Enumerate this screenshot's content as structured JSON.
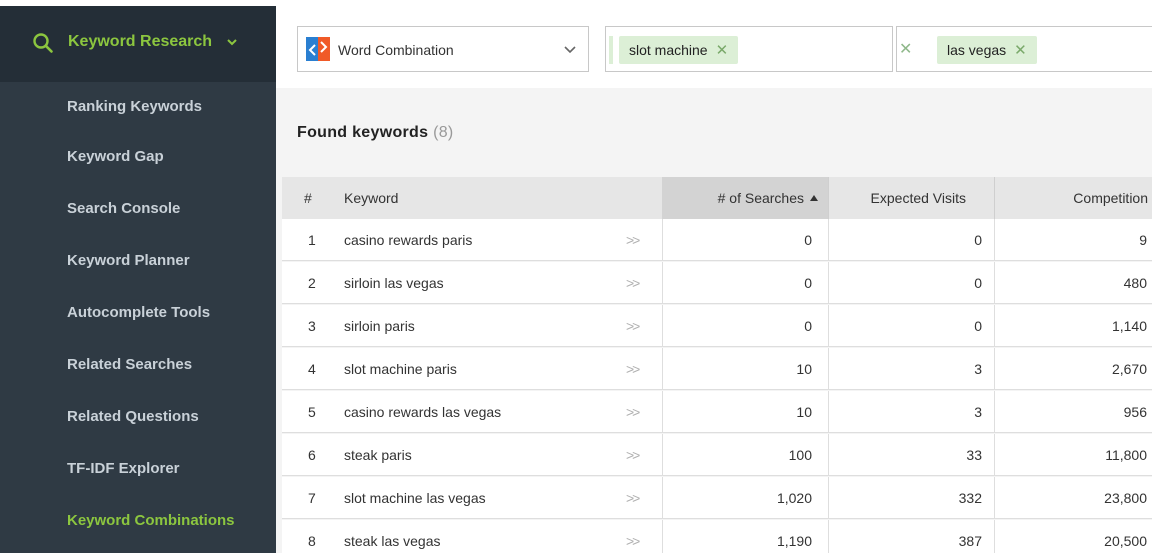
{
  "sidebar": {
    "section_title": "Keyword Research",
    "items": [
      {
        "label": "Ranking Keywords"
      },
      {
        "label": "Keyword Gap"
      },
      {
        "label": "Search Console"
      },
      {
        "label": "Keyword Planner"
      },
      {
        "label": "Autocomplete Tools"
      },
      {
        "label": "Related Searches"
      },
      {
        "label": "Related Questions"
      },
      {
        "label": "TF-IDF Explorer"
      },
      {
        "label": "Keyword Combinations",
        "active": true
      }
    ],
    "colors": {
      "bg": "#2f3a44",
      "active": "#8cc63f"
    }
  },
  "filter": {
    "method_select": "Word Combination",
    "tags_group1": [
      "slot machine"
    ],
    "tags_group2": [
      "las vegas"
    ]
  },
  "results": {
    "title": "Found keywords",
    "count": "(8)",
    "columns": {
      "num": "#",
      "keyword": "Keyword",
      "searches": "# of Searches",
      "visits": "Expected Visits",
      "competition": "Competition"
    },
    "rows": [
      {
        "num": "1",
        "keyword": "casino rewards paris",
        "searches": "0",
        "visits": "0",
        "competition": "9"
      },
      {
        "num": "2",
        "keyword": "sirloin las vegas",
        "searches": "0",
        "visits": "0",
        "competition": "480"
      },
      {
        "num": "3",
        "keyword": "sirloin paris",
        "searches": "0",
        "visits": "0",
        "competition": "1,140"
      },
      {
        "num": "4",
        "keyword": "slot machine paris",
        "searches": "10",
        "visits": "3",
        "competition": "2,670"
      },
      {
        "num": "5",
        "keyword": "casino rewards las vegas",
        "searches": "10",
        "visits": "3",
        "competition": "956"
      },
      {
        "num": "6",
        "keyword": "steak paris",
        "searches": "100",
        "visits": "33",
        "competition": "11,800"
      },
      {
        "num": "7",
        "keyword": "slot machine las vegas",
        "searches": "1,020",
        "visits": "332",
        "competition": "23,800"
      },
      {
        "num": "8",
        "keyword": "steak las vegas",
        "searches": "1,190",
        "visits": "387",
        "competition": "20,500"
      }
    ]
  }
}
